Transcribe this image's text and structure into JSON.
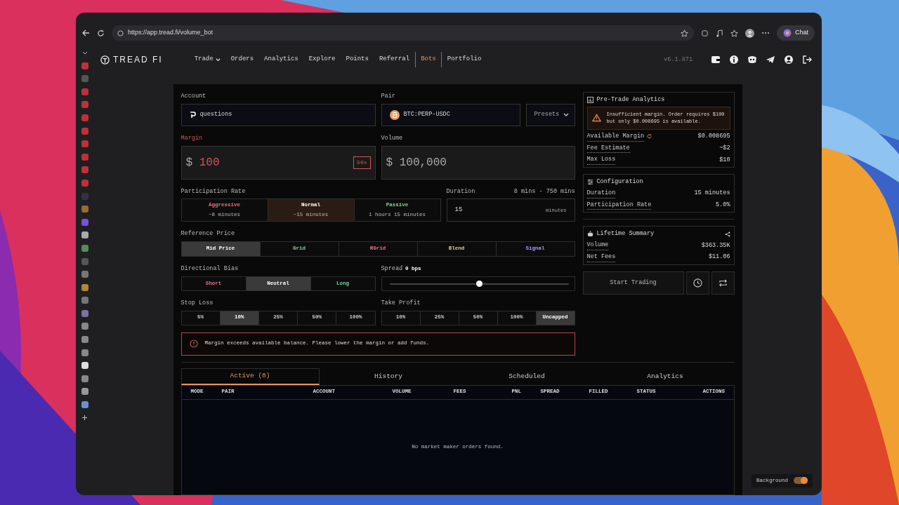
{
  "browser": {
    "url": "https://app.tread.fi/volume_bot",
    "chat_label": "Chat"
  },
  "nav": {
    "logo": "TREAD FI",
    "version": "v6.1.871",
    "items": [
      {
        "label": "Trade",
        "dropdown": true,
        "selected": false
      },
      {
        "label": "Orders",
        "dropdown": false,
        "selected": false
      },
      {
        "label": "Analytics",
        "dropdown": false,
        "selected": false
      },
      {
        "label": "Explore",
        "dropdown": false,
        "selected": false
      },
      {
        "label": "Points",
        "dropdown": false,
        "selected": false
      },
      {
        "label": "Referral",
        "dropdown": false,
        "selected": false
      },
      {
        "label": "Bots",
        "dropdown": false,
        "selected": true
      },
      {
        "label": "Portfolio",
        "dropdown": false,
        "selected": false
      }
    ]
  },
  "form": {
    "account": {
      "label": "Account",
      "value": "questions"
    },
    "pair": {
      "label": "Pair",
      "value": "BTC:PERP-USDC"
    },
    "presets": "Presets",
    "margin": {
      "label": "Margin",
      "currency": "$",
      "value": "100",
      "leverage": "50x",
      "error": true
    },
    "volume": {
      "label": "Volume",
      "currency": "$",
      "value": "100,000",
      "error": false
    },
    "participation": {
      "label": "Participation Rate",
      "options": [
        {
          "label": "Aggressive",
          "sub": "~8 minutes",
          "color": "#e8757d",
          "selected": false
        },
        {
          "label": "Normal",
          "sub": "~15 minutes",
          "selected": true
        },
        {
          "label": "Passive",
          "sub": "1 hours 15 minutes",
          "color": "#7fd99a",
          "selected": false
        }
      ]
    },
    "duration": {
      "label": "Duration",
      "range": "8 mins - 750 mins",
      "value": "15",
      "unit": "minutes"
    },
    "reference_price": {
      "label": "Reference Price",
      "options": [
        {
          "label": "Mid Price",
          "selected": true
        },
        {
          "label": "Grid",
          "color": "#7fd99a",
          "selected": false
        },
        {
          "label": "RGrid",
          "color": "#e8757d",
          "selected": false
        },
        {
          "label": "Blend",
          "color": "#f2c58a",
          "selected": false
        },
        {
          "label": "Signal",
          "color": "#a89cf5",
          "selected": false
        }
      ]
    },
    "directional_bias": {
      "label": "Directional Bias",
      "options": [
        {
          "label": "Short",
          "color": "#e8757d",
          "selected": false
        },
        {
          "label": "Neutral",
          "selected": true
        },
        {
          "label": "Long",
          "color": "#7fd99a",
          "selected": false
        }
      ]
    },
    "spread": {
      "label": "Spread",
      "value": "0 bps",
      "level": 0.5
    },
    "stop_loss": {
      "label": "Stop Loss",
      "options": [
        {
          "label": "5%",
          "selected": false
        },
        {
          "label": "10%",
          "selected": true
        },
        {
          "label": "25%",
          "selected": false
        },
        {
          "label": "50%",
          "selected": false
        },
        {
          "label": "100%",
          "selected": false
        }
      ]
    },
    "take_profit": {
      "label": "Take Profit",
      "options": [
        {
          "label": "10%",
          "selected": false
        },
        {
          "label": "25%",
          "selected": false
        },
        {
          "label": "50%",
          "selected": false
        },
        {
          "label": "100%",
          "selected": false
        },
        {
          "label": "Uncapped",
          "selected": true
        }
      ]
    },
    "alert": "Margin exceeds available balance. Please lower the margin or add funds."
  },
  "pre_trade": {
    "title": "Pre-Trade Analytics",
    "warning": "Insufficient margin. Order requires $100 but only $0.008695 is available.",
    "rows": [
      {
        "label": "Available Margin",
        "value": "$0.008695",
        "refresh": true
      },
      {
        "label": "Fee Estimate",
        "value": "~$2",
        "refresh": false
      },
      {
        "label": "Max Loss",
        "value": "$10",
        "refresh": false
      }
    ]
  },
  "configuration": {
    "title": "Configuration",
    "rows": [
      {
        "label": "Duration",
        "value": "15 minutes"
      },
      {
        "label": "Participation Rate",
        "value": "5.0%"
      }
    ]
  },
  "lifetime": {
    "title": "Lifetime Summary",
    "rows": [
      {
        "label": "Volume",
        "value": "$363.35K"
      },
      {
        "label": "Net Fees",
        "value": "$11.06"
      }
    ]
  },
  "start_button": "Start Trading",
  "tabs": [
    {
      "label": "Active (0)",
      "selected": true
    },
    {
      "label": "History",
      "selected": false
    },
    {
      "label": "Scheduled",
      "selected": false
    },
    {
      "label": "Analytics",
      "selected": false
    }
  ],
  "table": {
    "columns": [
      "MODE",
      "PAIR",
      "ACCOUNT",
      "VOLUME",
      "FEES",
      "PNL",
      "SPREAD",
      "FILLED",
      "STATUS",
      "ACTIONS"
    ],
    "empty_message": "No market maker orders found."
  },
  "background_toggle": {
    "label": "Background",
    "on": true
  }
}
